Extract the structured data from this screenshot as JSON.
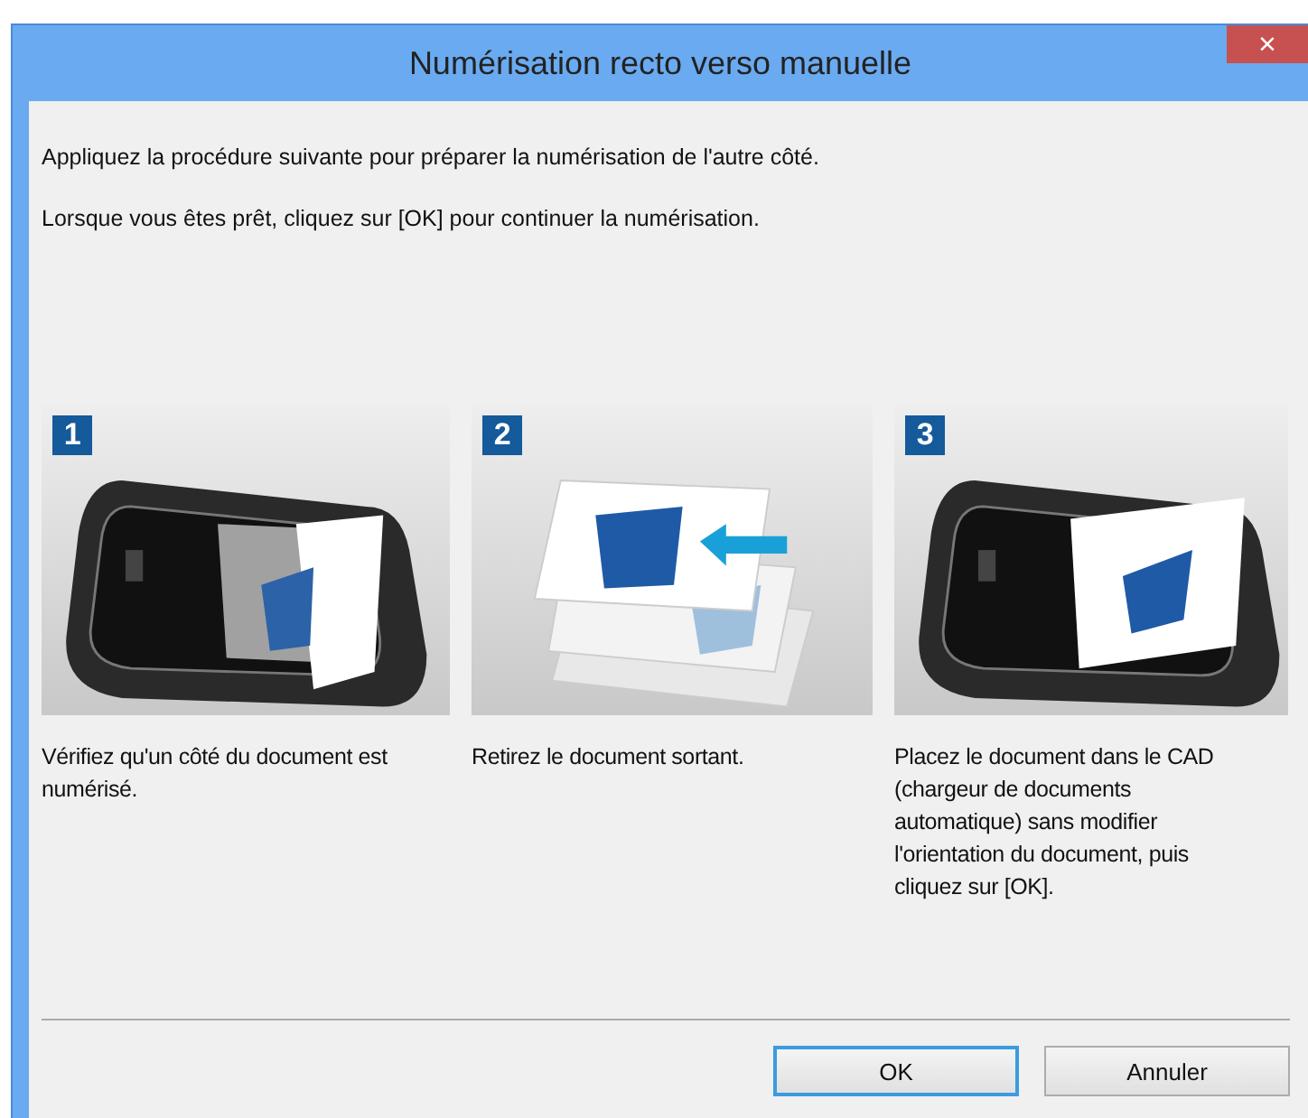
{
  "window": {
    "title": "Numérisation recto verso manuelle",
    "close": "×"
  },
  "instructions": [
    "Appliquez la procédure suivante pour préparer la numérisation de l'autre côté.",
    "Lorsque vous êtes prêt, cliquez sur [OK] pour continuer la numérisation."
  ],
  "steps": [
    {
      "number": "1",
      "kind": "scanner-check",
      "caption": "Vérifiez qu'un côté du document est numérisé."
    },
    {
      "number": "2",
      "kind": "remove",
      "caption": "Retirez le document sortant."
    },
    {
      "number": "3",
      "kind": "scanner-place",
      "caption": "Placez le document dans le CAD (chargeur de documents automatique) sans modifier l'orientation du document, puis cliquez sur [OK]."
    }
  ],
  "buttons": [
    {
      "label": "OK",
      "default": true
    },
    {
      "label": "Annuler",
      "default": false
    }
  ]
}
